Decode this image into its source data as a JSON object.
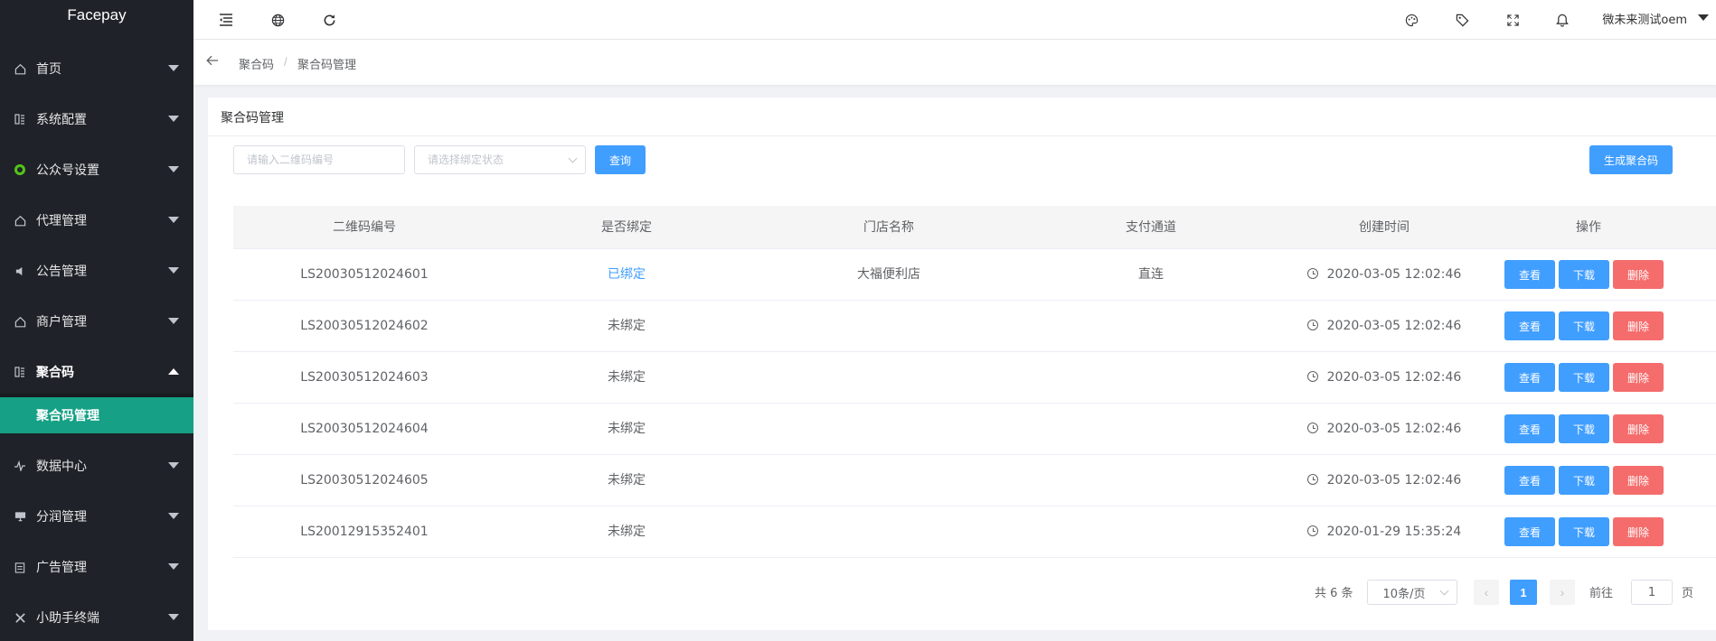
{
  "app": {
    "title": "Facepay"
  },
  "sidebar": {
    "items": [
      {
        "label": "首页",
        "icon": "home-icon"
      },
      {
        "label": "系统配置",
        "icon": "grid-icon"
      },
      {
        "label": "公众号设置",
        "icon": "wechat-icon"
      },
      {
        "label": "代理管理",
        "icon": "home-icon"
      },
      {
        "label": "公告管理",
        "icon": "speaker-icon"
      },
      {
        "label": "商户管理",
        "icon": "home-icon"
      },
      {
        "label": "聚合码",
        "icon": "grid-icon",
        "expanded": true
      },
      {
        "label": "数据中心",
        "icon": "pulse-icon"
      },
      {
        "label": "分润管理",
        "icon": "monitor-icon"
      },
      {
        "label": "广告管理",
        "icon": "clipboard-icon"
      },
      {
        "label": "小助手终端",
        "icon": "tools-icon"
      }
    ],
    "submenu": {
      "label": "聚合码管理"
    },
    "active_color": "#16a085"
  },
  "header": {
    "user": "微未来测试oem",
    "icons": [
      "menu-fold-icon",
      "globe-icon",
      "refresh-icon",
      "palette-icon",
      "tag-icon",
      "fullscreen-icon",
      "bell-icon"
    ]
  },
  "breadcrumb": {
    "items": [
      "聚合码",
      "聚合码管理"
    ],
    "separator": "/"
  },
  "card": {
    "title": "聚合码管理"
  },
  "filters": {
    "code_placeholder": "请输入二维码编号",
    "status_placeholder": "请选择绑定状态",
    "query_label": "查询",
    "generate_label": "生成聚合码"
  },
  "table": {
    "columns": [
      "二维码编号",
      "是否绑定",
      "门店名称",
      "支付通道",
      "创建时间",
      "操作"
    ],
    "rows": [
      {
        "code": "LS20030512024601",
        "bound": "已绑定",
        "store": "大福便利店",
        "channel": "直连",
        "created": "2020-03-05 12:02:46"
      },
      {
        "code": "LS20030512024602",
        "bound": "未绑定",
        "store": "",
        "channel": "",
        "created": "2020-03-05 12:02:46"
      },
      {
        "code": "LS20030512024603",
        "bound": "未绑定",
        "store": "",
        "channel": "",
        "created": "2020-03-05 12:02:46"
      },
      {
        "code": "LS20030512024604",
        "bound": "未绑定",
        "store": "",
        "channel": "",
        "created": "2020-03-05 12:02:46"
      },
      {
        "code": "LS20030512024605",
        "bound": "未绑定",
        "store": "",
        "channel": "",
        "created": "2020-03-05 12:02:46"
      },
      {
        "code": "LS20012915352401",
        "bound": "未绑定",
        "store": "",
        "channel": "",
        "created": "2020-01-29 15:35:24"
      }
    ],
    "actions": {
      "view": "查看",
      "download": "下载",
      "delete": "删除"
    }
  },
  "pagination": {
    "total_text": "共 6 条",
    "page_size": "10条/页",
    "current_page": "1",
    "goto_prefix": "前往",
    "goto_value": "1",
    "goto_suffix": "页"
  }
}
